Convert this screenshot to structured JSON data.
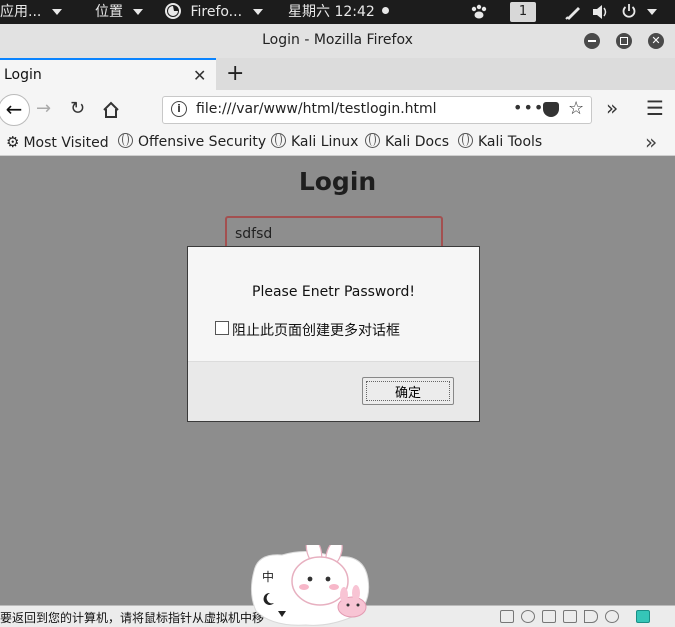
{
  "topbar": {
    "apps": "应用...",
    "places": "位置",
    "firefox": "Firefo...",
    "clock": "星期六 12:42",
    "workspace": "1"
  },
  "window": {
    "title": "Login - Mozilla Firefox"
  },
  "tab": {
    "label": "Login"
  },
  "address": {
    "url": "file:///var/www/html/testlogin.html",
    "menu_dots": "•••"
  },
  "bookmarks": {
    "items": [
      "Most Visited",
      "Offensive Security",
      "Kali Linux",
      "Kali Docs",
      "Kali Tools"
    ]
  },
  "page": {
    "heading": "Login",
    "username_value": "sdfsd"
  },
  "dialog": {
    "message": "Please Enetr Password!",
    "checkbox_label": "阻止此页面创建更多对话框",
    "ok_label": "确定"
  },
  "vm_status": {
    "hint": "要返回到您的计算机，请将鼠标指针从虚拟机中移"
  },
  "sticker": {
    "ime_char": "中"
  },
  "colors": {
    "topbar_bg": "#1c1c1c",
    "tab_accent": "#0a84ff",
    "overlay_bg": "#8d8d8d",
    "field_border": "#a35050"
  }
}
